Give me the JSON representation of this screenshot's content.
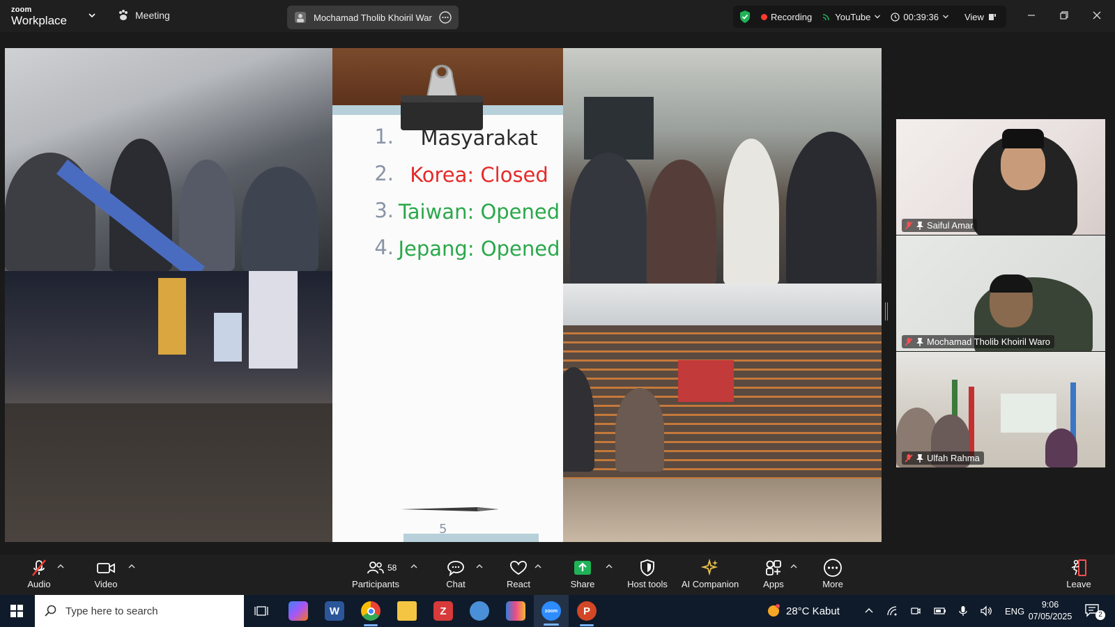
{
  "app": {
    "logo_top": "zoom",
    "logo_bottom": "Workplace",
    "meeting_label": "Meeting",
    "share_title": "Mochamad Tholib Khoiril Waro's"
  },
  "status": {
    "recording_label": "Recording",
    "stream_label": "YouTube",
    "timer": "00:39:36",
    "view_label": "View"
  },
  "slide": {
    "items": [
      {
        "num": "1.",
        "text": "Masyarakat",
        "color": "#2b2b2b"
      },
      {
        "num": "2.",
        "text": "Korea: Closed",
        "color": "#e62a2a"
      },
      {
        "num": "3.",
        "text": "Taiwan: Opened",
        "color": "#2aa84a"
      },
      {
        "num": "4.",
        "text": "Jepang: Opened",
        "color": "#2aa84a"
      }
    ],
    "page_number": "5"
  },
  "participants": [
    {
      "name": "Saiful Amar"
    },
    {
      "name": "Mochamad Tholib Khoiril Waro"
    },
    {
      "name": "Ulfah Rahma"
    }
  ],
  "toolbar": {
    "audio": "Audio",
    "video": "Video",
    "participants": "Participants",
    "participants_count": "58",
    "chat": "Chat",
    "react": "React",
    "share": "Share",
    "host_tools": "Host tools",
    "ai_companion": "AI Companion",
    "apps": "Apps",
    "more": "More",
    "leave": "Leave"
  },
  "taskbar": {
    "search_placeholder": "Type here to search",
    "weather": "28°C Kabut",
    "language": "ENG",
    "time": "9:06",
    "date": "07/05/2025",
    "notifications": "2"
  },
  "colors": {
    "accent_green": "#1fb257",
    "record_red": "#ff3b30",
    "taskbar_bg": "#0f1b2b"
  }
}
